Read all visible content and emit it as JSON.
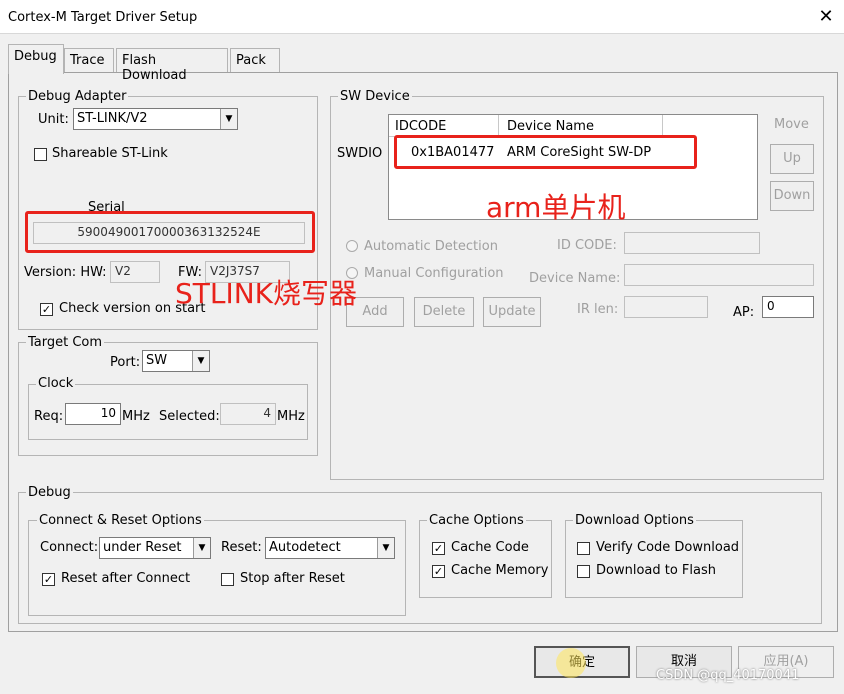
{
  "window": {
    "title": "Cortex-M Target Driver Setup",
    "close": "✕"
  },
  "tabs": [
    "Debug",
    "Trace",
    "Flash Download",
    "Pack"
  ],
  "debug_adapter": {
    "title": "Debug Adapter",
    "unit_label": "Unit:",
    "unit_value": "ST-LINK/V2",
    "shareable_label": "Shareable ST-Link",
    "serial_label": "Serial",
    "serial_value": "590049001700003631325​24E",
    "version_label": "Version: HW:",
    "hw_value": "V2",
    "fw_label": "FW:",
    "fw_value": "V2J37S7",
    "check_version_label": "Check version on start"
  },
  "target_com": {
    "title": "Target Com",
    "port_label": "Port:",
    "port_value": "SW",
    "clock_title": "Clock",
    "req_label": "Req:",
    "req_value": "10",
    "mhz1": "MHz",
    "selected_label": "Selected:",
    "selected_value": "4",
    "mhz2": "MHz"
  },
  "sw_device": {
    "title": "SW Device",
    "swdio_label": "SWDIO",
    "col_idcode": "IDCODE",
    "col_device": "Device Name",
    "row_idcode": "0x1BA01477",
    "row_device": "ARM CoreSight SW-DP",
    "move_label": "Move",
    "up_label": "Up",
    "down_label": "Down",
    "auto_detect": "Automatic Detection",
    "manual_config": "Manual Configuration",
    "idcode_label": "ID CODE:",
    "device_name_label": "Device Name:",
    "ir_len_label": "IR len:",
    "ap_label": "AP:",
    "ap_value": "0",
    "add": "Add",
    "delete": "Delete",
    "update": "Update"
  },
  "annotations": {
    "arm": "arm单片机",
    "stlink": "STLINK烧写器"
  },
  "debug_group": {
    "title": "Debug",
    "connect_reset_title": "Connect & Reset Options",
    "connect_label": "Connect:",
    "connect_value": "under Reset",
    "reset_label": "Reset:",
    "reset_value": "Autodetect",
    "reset_after_connect": "Reset after Connect",
    "stop_after_reset": "Stop after Reset",
    "cache_title": "Cache Options",
    "cache_code": "Cache Code",
    "cache_memory": "Cache Memory",
    "download_title": "Download Options",
    "verify_code": "Verify Code Download",
    "download_flash": "Download to Flash"
  },
  "footer": {
    "ok": "确定",
    "cancel": "取消",
    "apply": "应用(A)",
    "watermark": "CSDN @qq_40170041"
  }
}
